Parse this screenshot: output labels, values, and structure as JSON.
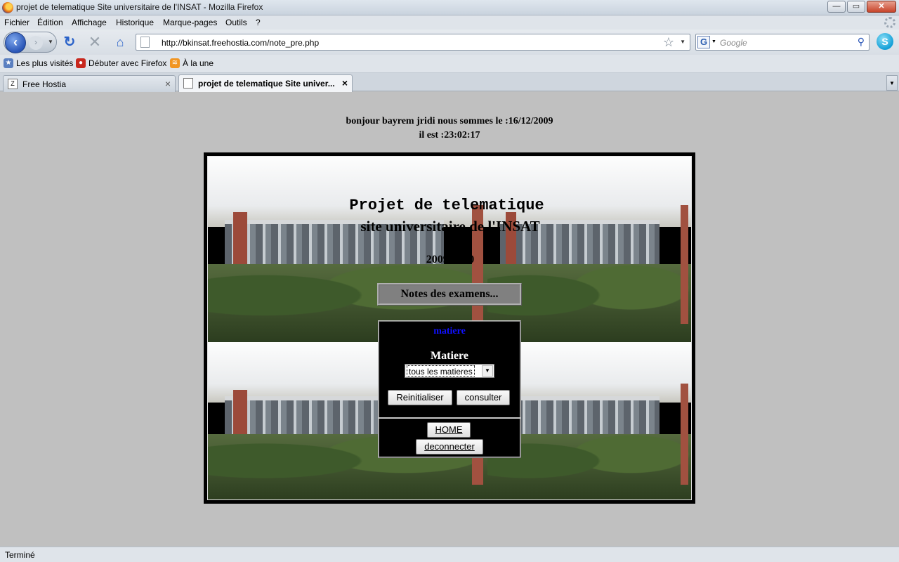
{
  "window": {
    "title": "projet de telematique Site universitaire de l'INSAT - Mozilla Firefox",
    "buttons": {
      "minimize": "—",
      "maximize": "▭",
      "close": "✕"
    }
  },
  "menu": [
    "Fichier",
    "Édition",
    "Affichage",
    "Historique",
    "Marque-pages",
    "Outils",
    "?"
  ],
  "toolbar": {
    "url": "http://bkinsat.freehostia.com/note_pre.php",
    "search_placeholder": "Google",
    "search_engine": "G"
  },
  "bookmarks": [
    "Les plus visités",
    "Débuter avec Firefox",
    "À la une"
  ],
  "tabs": [
    {
      "label": "Free Hostia",
      "active": false
    },
    {
      "label": "projet de telematique Site univer...",
      "active": true
    }
  ],
  "page": {
    "greeting": "bonjour bayrem jridi nous sommes le :16/12/2009",
    "time": "il est :23:02:17",
    "heading": "Projet de telematique",
    "subheading": "site universitaire de l'INSAT",
    "year": "2009/2010",
    "notes_title": "Notes des examens...",
    "matiere_link": "matiere",
    "matiere_label": "Matiere",
    "matiere_selected": "tous les matieres",
    "reset_label": "Reinitialiser",
    "submit_label": "consulter",
    "home_label": "HOME",
    "logout_label": "deconnecter"
  },
  "status": "Terminé",
  "icons": {
    "app": "firefox-icon",
    "back": "back-arrow-icon",
    "forward": "forward-arrow-icon",
    "reload": "reload-icon",
    "stop": "stop-icon",
    "home": "home-icon",
    "bookmark_star": "star-icon",
    "search": "magnifier-icon",
    "addon": "skype-icon"
  },
  "colors": {
    "page_bg": "#c0c0c0",
    "link": "#1010ff",
    "frame": "#000000"
  }
}
